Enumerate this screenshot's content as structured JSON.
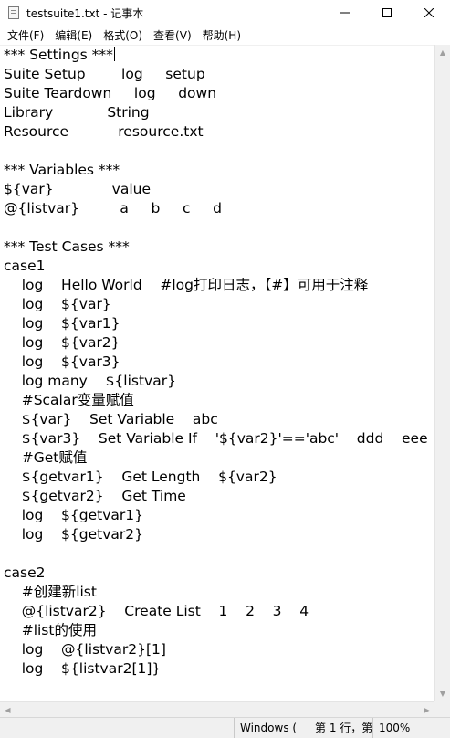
{
  "window": {
    "title": "testsuite1.txt - 记事本",
    "icon": "notepad-icon",
    "controls": {
      "minimize": "—",
      "maximize": "☐",
      "close": "✕"
    }
  },
  "menu": [
    "文件(F)",
    "编辑(E)",
    "格式(O)",
    "查看(V)",
    "帮助(H)"
  ],
  "editor": {
    "lines": [
      "*** Settings ***",
      "Suite Setup        log     setup",
      "Suite Teardown     log     down",
      "Library            String",
      "Resource           resource.txt",
      "",
      "*** Variables ***",
      "${var}             value",
      "@{listvar}         a     b     c     d",
      "",
      "*** Test Cases ***",
      "case1",
      "    log    Hello World    #log打印日志，【#】可用于注释",
      "    log    ${var}",
      "    log    ${var1}",
      "    log    ${var2}",
      "    log    ${var3}",
      "    log many    ${listvar}",
      "    #Scalar变量赋值",
      "    ${var}    Set Variable    abc",
      "    ${var3}    Set Variable If    '${var2}'=='abc'    ddd    eee",
      "    #Get赋值",
      "    ${getvar1}    Get Length    ${var2}",
      "    ${getvar2}    Get Time",
      "    log    ${getvar1}",
      "    log    ${getvar2}",
      "",
      "case2",
      "    #创建新list",
      "    @{listvar2}    Create List    1    2    3    4",
      "    #list的使用",
      "    log    @{listvar2}[1]",
      "    log    ${listvar2[1]}"
    ]
  },
  "status": {
    "line_ending": "Windows (",
    "position": "第 1 行，第",
    "zoom": "100%"
  }
}
